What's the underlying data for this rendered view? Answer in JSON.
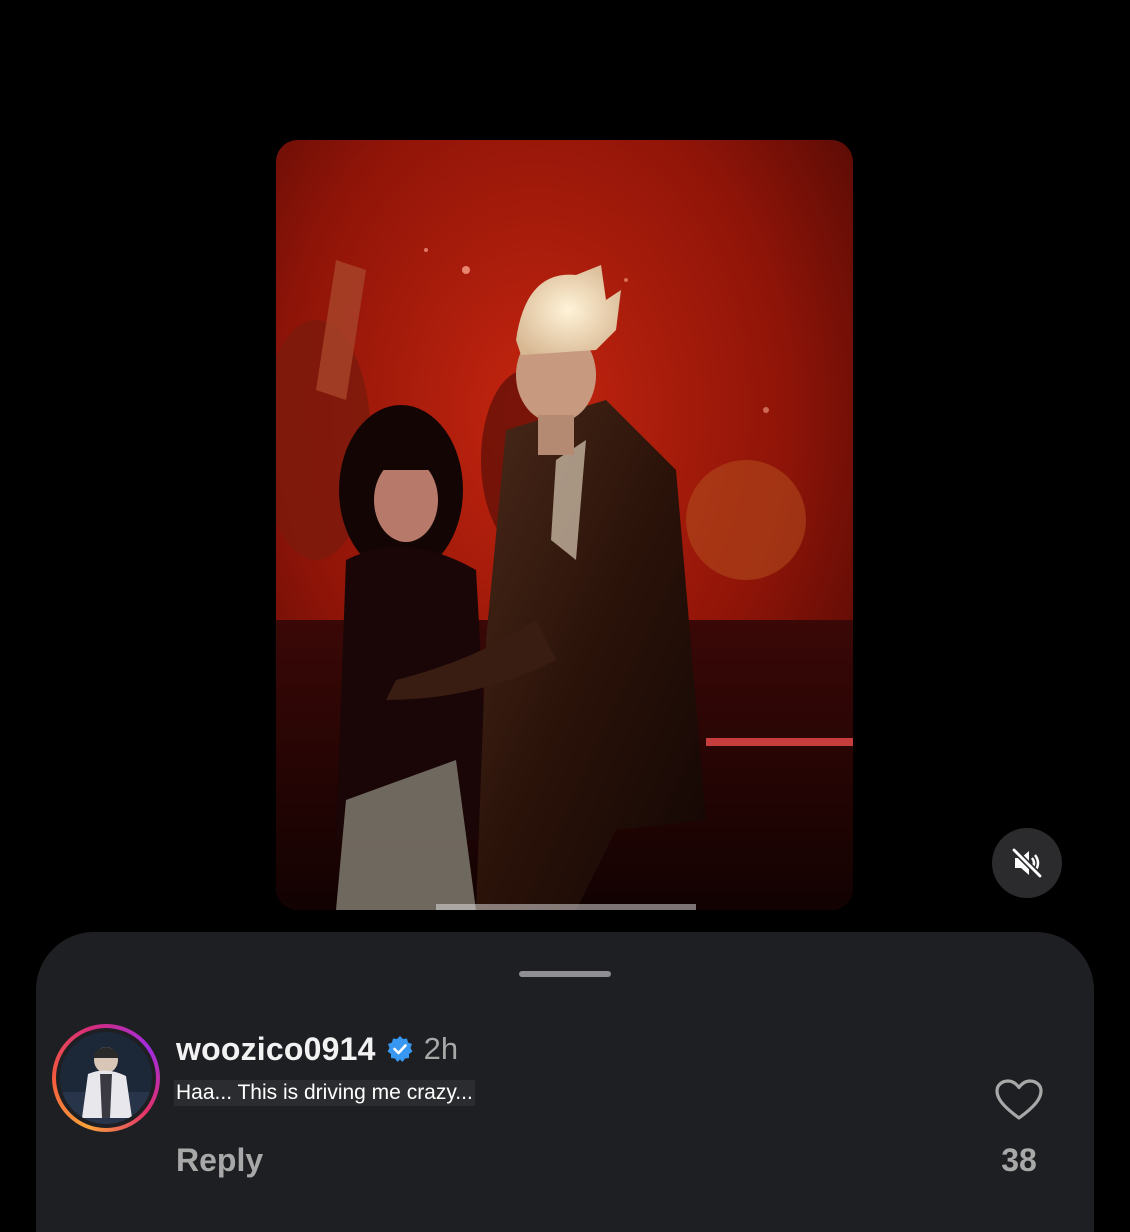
{
  "video": {
    "muted": true,
    "mute_icon": "speaker-muted-icon"
  },
  "comment": {
    "username": "woozico0914",
    "verified_icon": "verified-badge-icon",
    "timestamp": "2h",
    "text": "Haa... This is driving me crazy...",
    "reply_label": "Reply",
    "like_icon": "heart-outline-icon",
    "like_count": "38"
  },
  "colors": {
    "background": "#000000",
    "sheet": "#1e1f22",
    "muted_text": "#a8a8a8",
    "verified_blue": "#3897f0",
    "story_ring": [
      "#f9a23a",
      "#e1306c",
      "#a02ce0"
    ]
  }
}
